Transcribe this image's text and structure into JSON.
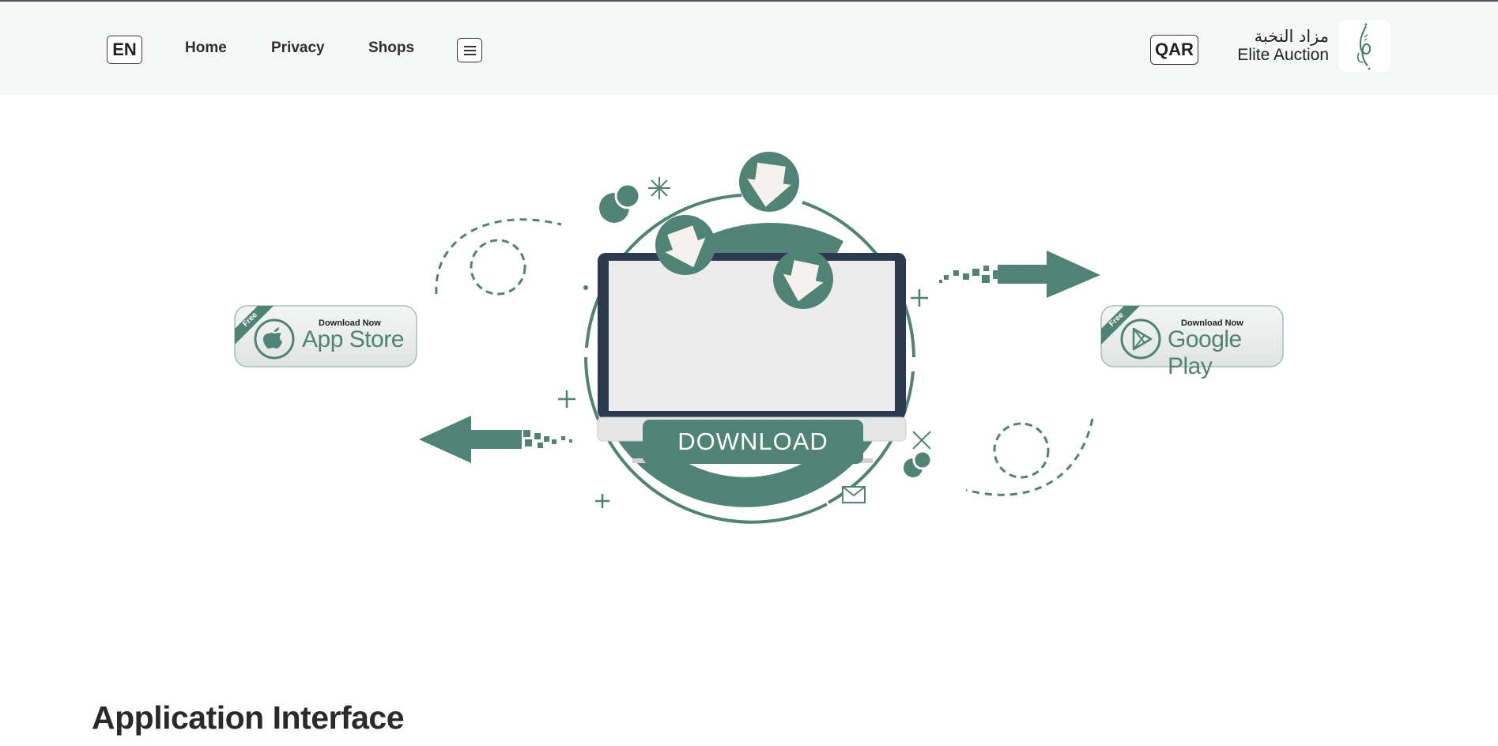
{
  "header": {
    "language_label": "EN",
    "nav": {
      "home": "Home",
      "privacy": "Privacy",
      "shops": "Shops"
    },
    "currency_label": "QAR",
    "brand_arabic": "مزاد النخبة",
    "brand_english": "Elite Auction"
  },
  "hero": {
    "download_label": "DOWNLOAD",
    "app_store": {
      "tag": "Free",
      "small_text": "Download Now",
      "big_text": "App Store"
    },
    "google_play": {
      "tag": "Free",
      "small_text": "Download Now",
      "big_text": "Google Play"
    }
  },
  "section": {
    "title": "Application Interface"
  },
  "colors": {
    "accent": "#4f8374",
    "monitor_frame": "#2c3a4f",
    "header_bg": "#f5f7f6"
  },
  "icons": [
    "menu-icon",
    "logo-icon",
    "apple-icon",
    "play-icon",
    "download-arrow-icon",
    "mail-icon"
  ]
}
